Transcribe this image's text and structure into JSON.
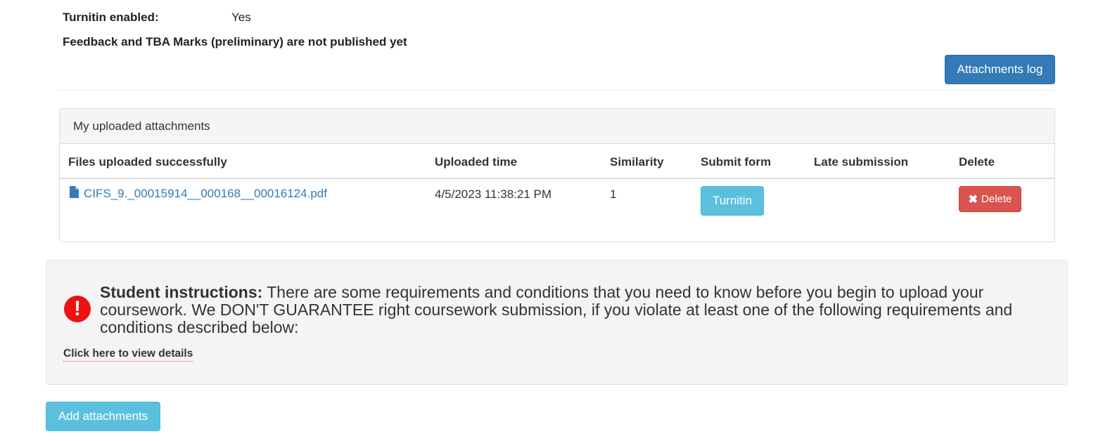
{
  "info": {
    "turnitin_label": "Turnitin enabled:",
    "turnitin_value": "Yes",
    "feedback_notice": "Feedback and TBA Marks (preliminary) are not published yet"
  },
  "buttons": {
    "attachments_log": "Attachments log",
    "add_attachments": "Add attachments"
  },
  "panel": {
    "title": "My uploaded attachments",
    "columns": [
      "Files uploaded successfully",
      "Uploaded time",
      "Similarity",
      "Submit form",
      "Late submission",
      "Delete"
    ],
    "rows": [
      {
        "file_name": "CIFS_9._00015914__000168__00016124.pdf",
        "uploaded_time": "4/5/2023 11:38:21 PM",
        "similarity": "1",
        "submit_form_label": "Turnitin",
        "late_submission": "",
        "delete_label": "Delete"
      }
    ]
  },
  "instructions": {
    "icon": "exclamation-circle-icon",
    "bold_label": "Student instructions:",
    "text": " There are some requirements and conditions that you need to know before you begin to upload your coursework. We DON'T GUARANTEE right coursework submission, if you violate at least one of the following requirements and conditions described below:",
    "link_text": "Click here to view details"
  },
  "colors": {
    "primary": "#337ab7",
    "info": "#5bc0de",
    "danger": "#d9534f",
    "alert_icon": "#ee1111"
  }
}
